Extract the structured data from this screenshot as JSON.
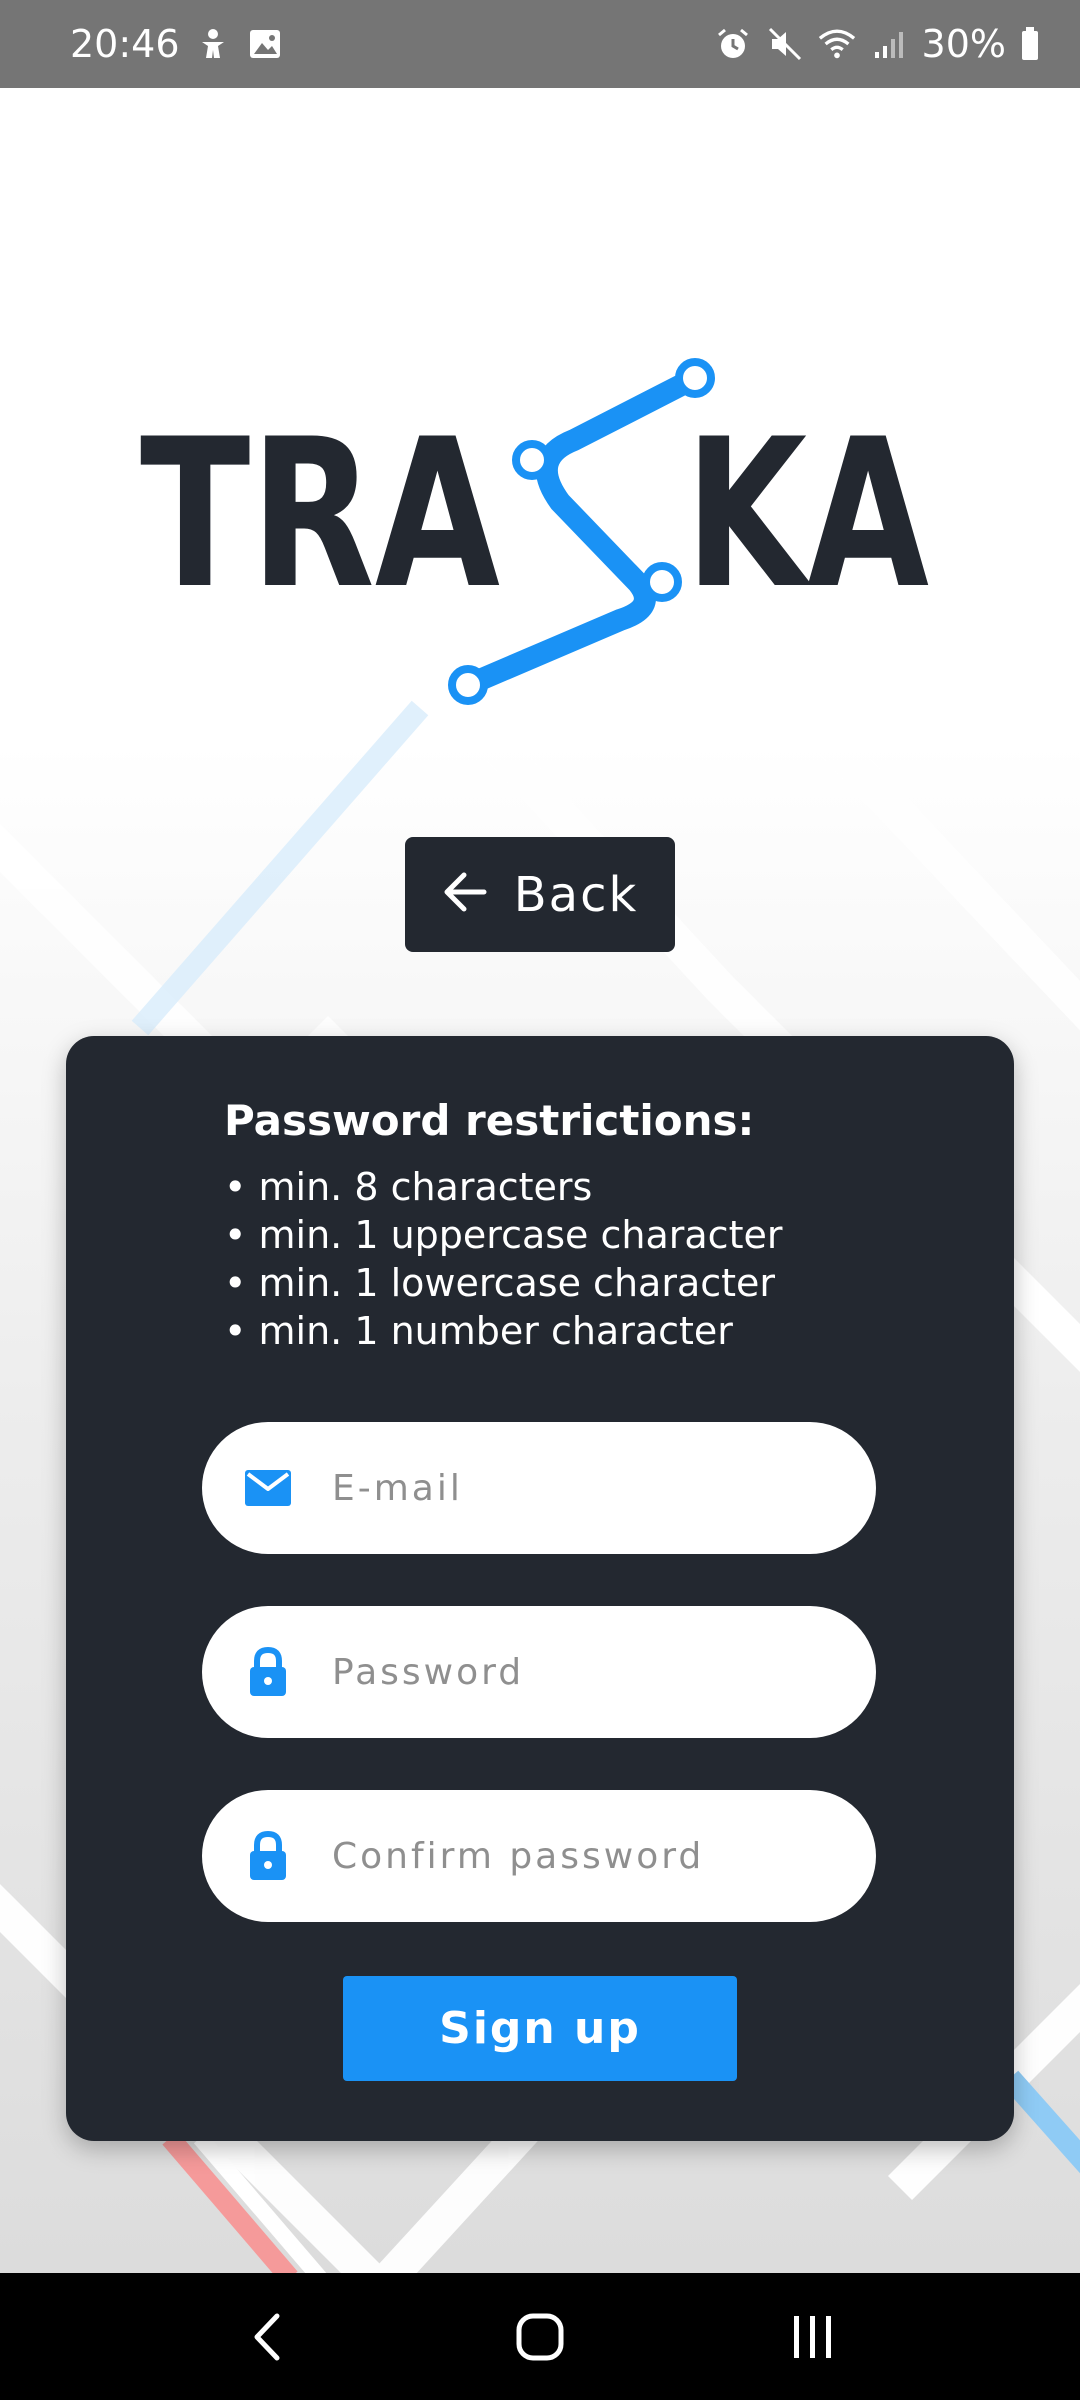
{
  "status_bar": {
    "time": "20:46",
    "battery": "30%",
    "icons_left": [
      "accessibility-icon",
      "image-icon"
    ],
    "icons_right": [
      "alarm-icon",
      "mute-icon",
      "wifi-icon",
      "signal-icon",
      "battery-icon"
    ]
  },
  "logo": {
    "left_text": "TRA",
    "right_text": "KA",
    "accent_color": "#1a92f5",
    "text_color": "#232830"
  },
  "back_button": {
    "label": "Back",
    "icon": "arrow-left-icon"
  },
  "restrictions": {
    "title": "Password restrictions:",
    "items": [
      "min. 8 characters",
      "min. 1 uppercase character",
      "min. 1 lowercase character",
      "min. 1 number character"
    ]
  },
  "form": {
    "email_placeholder": "E-mail",
    "password_placeholder": "Password",
    "confirm_placeholder": "Confirm password",
    "email_icon": "mail-icon",
    "password_icon": "lock-icon",
    "signup_label": "Sign up"
  },
  "colors": {
    "card_bg": "#232830",
    "accent": "#1a92f5",
    "status_bar": "#757575"
  },
  "nav_bar": {
    "buttons": [
      "back-nav-icon",
      "home-nav-icon",
      "recents-nav-icon"
    ]
  }
}
